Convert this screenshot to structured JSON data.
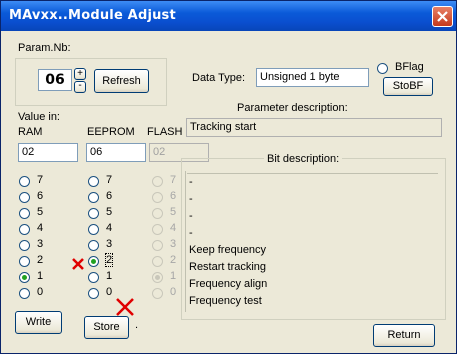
{
  "window": {
    "title": "MAvxx..Module Adjust"
  },
  "param": {
    "label": "Param.Nb:",
    "value": "06",
    "up": "+",
    "down": "-",
    "refresh": "Refresh"
  },
  "data_type": {
    "label": "Data Type:",
    "value": "Unsigned 1 byte"
  },
  "bflag": {
    "label": "BFlag",
    "stobf": "StoBF"
  },
  "param_desc": {
    "label": "Parameter description:",
    "value": "Tracking start"
  },
  "value_in": {
    "label": "Value in:",
    "ram": "RAM",
    "eeprom": "EEPROM",
    "flash": "FLASH"
  },
  "fields": {
    "ram": "02",
    "eeprom": "06",
    "flash": "02"
  },
  "radio_labels": [
    "7",
    "6",
    "5",
    "4",
    "3",
    "2",
    "1",
    "0"
  ],
  "bit_desc": {
    "label": "Bit description:",
    "items": [
      "-",
      "-",
      "-",
      "-",
      "Keep frequency",
      "Restart tracking",
      "Frequency align",
      "Frequency test"
    ]
  },
  "buttons": {
    "write": "Write",
    "store": "Store",
    "store_suffix": ".",
    "return": "Return"
  },
  "colors": {
    "title_bar": "#0a5ad8",
    "annotation_mark": "#e00000",
    "radio_checked": "#21a121"
  }
}
